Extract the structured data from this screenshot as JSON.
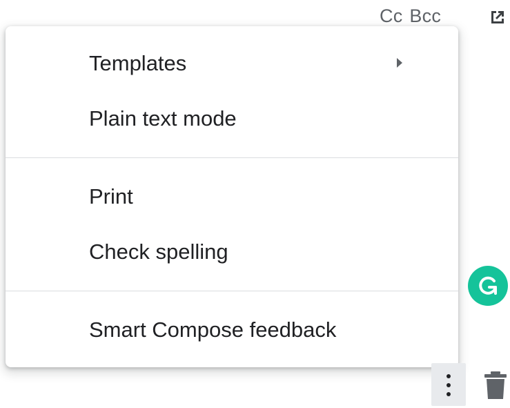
{
  "recipients": {
    "cc_label": "Cc",
    "bcc_label": "Bcc"
  },
  "menu": {
    "items": [
      {
        "label": "Templates",
        "has_submenu": true
      },
      {
        "label": "Plain text mode"
      },
      {
        "label": "Print"
      },
      {
        "label": "Check spelling"
      },
      {
        "label": "Smart Compose feedback"
      }
    ]
  },
  "icons": {
    "popout": "open-in-new-icon",
    "grammarly": "grammarly-icon",
    "more": "more-vert-icon",
    "discard": "trash-icon"
  },
  "colors": {
    "grammarly_green": "#15c39a",
    "text": "#202124",
    "secondary_text": "#5f6368",
    "divider": "#dadce0"
  }
}
